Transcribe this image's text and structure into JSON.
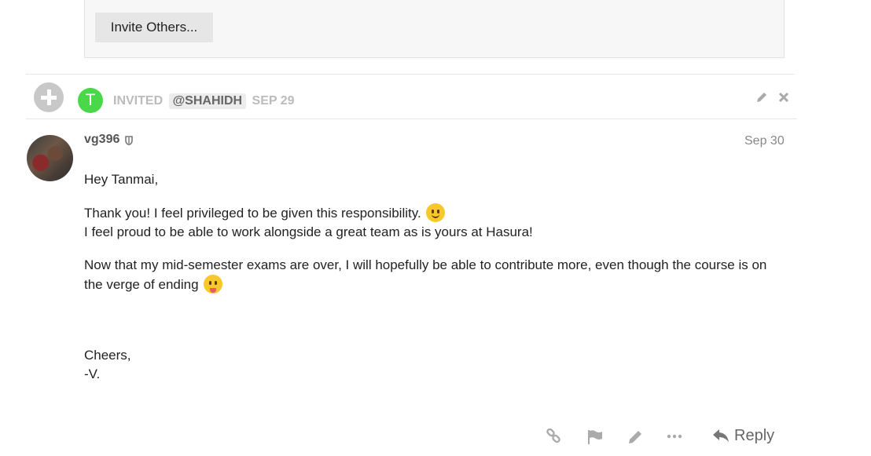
{
  "invite_box": {
    "button_label": "Invite Others..."
  },
  "small_action": {
    "avatar_letter": "T",
    "action": "INVITED",
    "mention": "@SHAHIDH",
    "date": "SEP 29",
    "icons": [
      "plus-icon",
      "pencil-icon",
      "close-icon"
    ]
  },
  "post": {
    "username": "vg396",
    "badge_icon": "shield-icon",
    "date": "Sep 30",
    "greeting": "Hey Tanmai,",
    "line1": "Thank you! I feel privileged to be given this responsibility.",
    "line2": "I feel proud to be able to work alongside a great team as is yours at Hasura!",
    "para2": "Now that my mid-semester exams are over, I will hopefully be able to contribute more, even though the course is on the verge of ending",
    "signoff1": "Cheers,",
    "signoff2": "-V."
  },
  "post_actions": {
    "icons": [
      "link-icon",
      "flag-icon",
      "pencil-icon",
      "more-icon",
      "reply-icon"
    ],
    "reply_label": "Reply"
  },
  "colors": {
    "avatar_green": "#49d849",
    "muted_text": "#bbbbbb",
    "icon_gray": "#aaaaaa"
  }
}
